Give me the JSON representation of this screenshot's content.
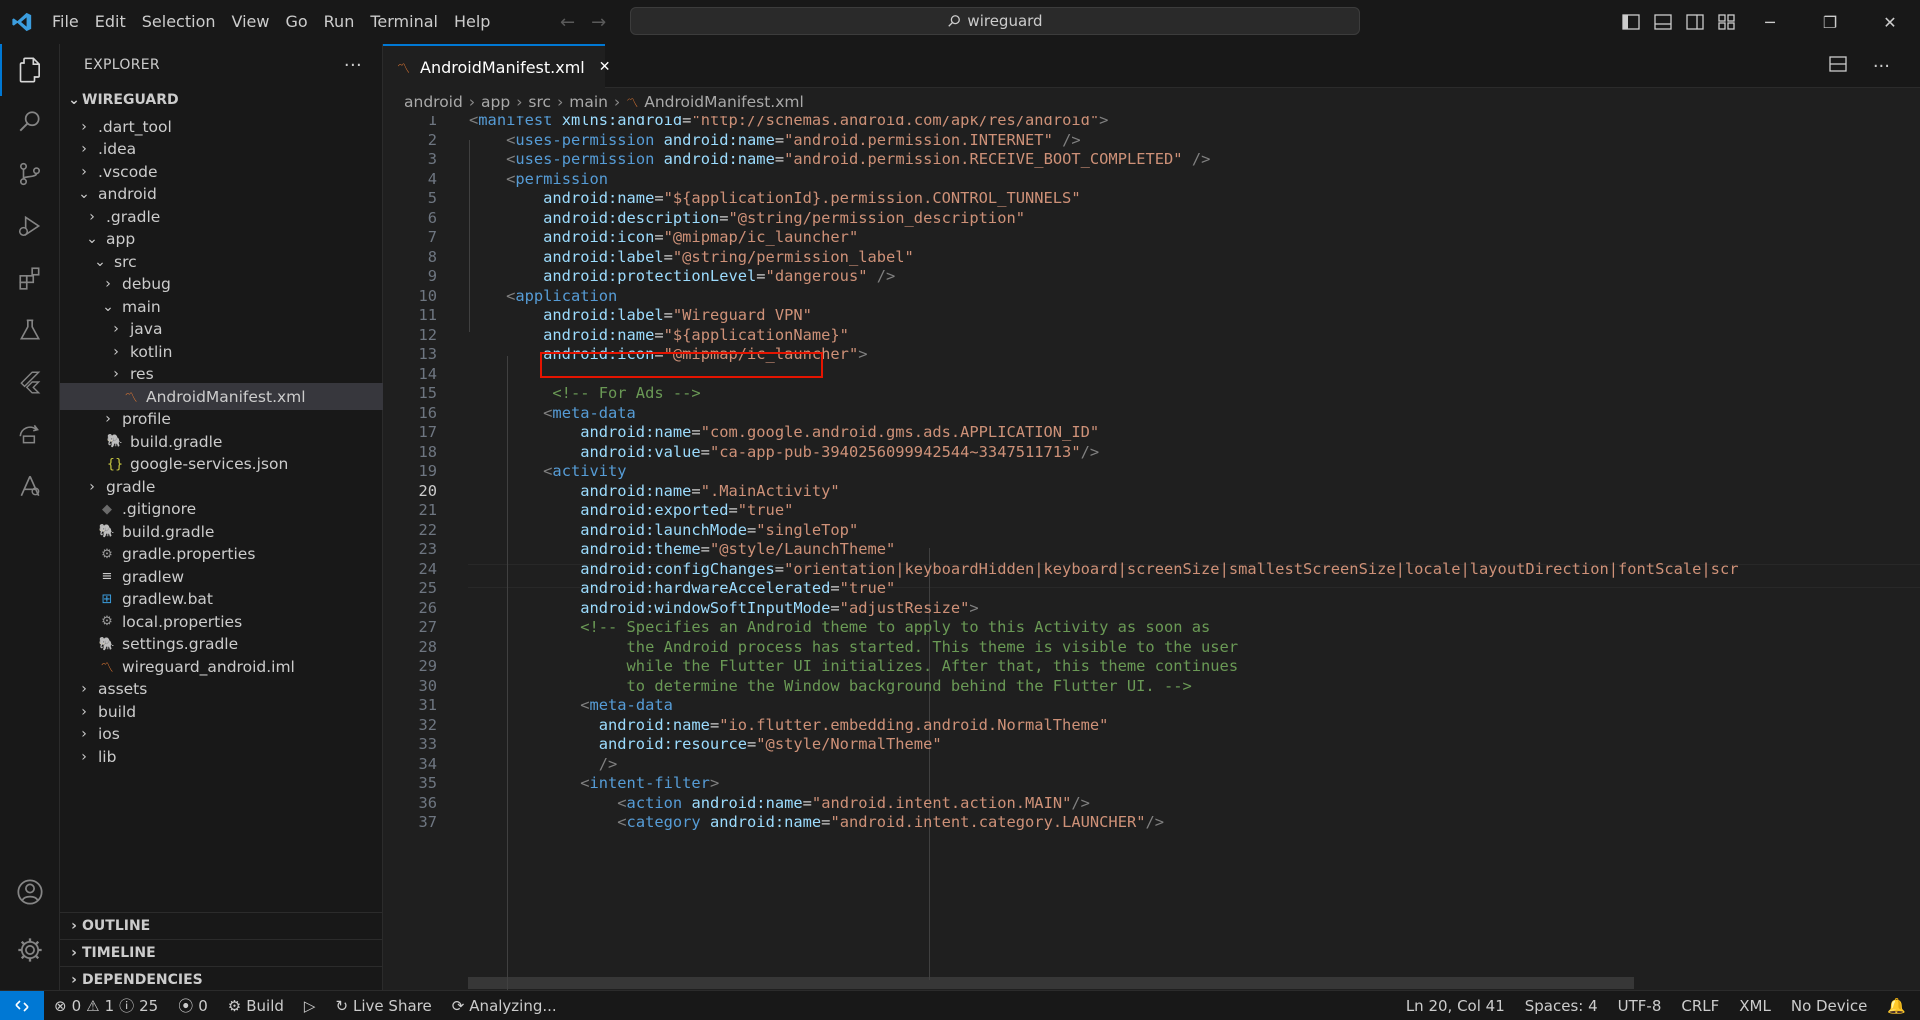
{
  "menu": [
    "File",
    "Edit",
    "Selection",
    "View",
    "Go",
    "Run",
    "Terminal",
    "Help"
  ],
  "command_center": {
    "text": "wireguard",
    "icon": "search-icon"
  },
  "sidebar": {
    "title": "EXPLORER",
    "more": "···",
    "root": "WIREGUARD",
    "tree": [
      {
        "label": ".dart_tool",
        "depth": 1,
        "kind": "folder",
        "open": false,
        "icon": ""
      },
      {
        "label": ".idea",
        "depth": 1,
        "kind": "folder",
        "open": false,
        "icon": ""
      },
      {
        "label": ".vscode",
        "depth": 1,
        "kind": "folder",
        "open": false,
        "icon": ""
      },
      {
        "label": "android",
        "depth": 1,
        "kind": "folder",
        "open": true,
        "icon": ""
      },
      {
        "label": ".gradle",
        "depth": 2,
        "kind": "folder",
        "open": false,
        "icon": ""
      },
      {
        "label": "app",
        "depth": 2,
        "kind": "folder",
        "open": true,
        "icon": ""
      },
      {
        "label": "src",
        "depth": 3,
        "kind": "folder",
        "open": true,
        "icon": ""
      },
      {
        "label": "debug",
        "depth": 4,
        "kind": "folder",
        "open": false,
        "icon": ""
      },
      {
        "label": "main",
        "depth": 4,
        "kind": "folder",
        "open": true,
        "icon": ""
      },
      {
        "label": "java",
        "depth": 5,
        "kind": "folder",
        "open": false,
        "icon": ""
      },
      {
        "label": "kotlin",
        "depth": 5,
        "kind": "folder",
        "open": false,
        "icon": ""
      },
      {
        "label": "res",
        "depth": 5,
        "kind": "folder",
        "open": false,
        "icon": ""
      },
      {
        "label": "AndroidManifest.xml",
        "depth": 5,
        "kind": "file",
        "icon": "rss-icon",
        "selected": true
      },
      {
        "label": "profile",
        "depth": 4,
        "kind": "folder",
        "open": false,
        "icon": ""
      },
      {
        "label": "build.gradle",
        "depth": 3,
        "kind": "file",
        "icon": "gradle-elephant-icon"
      },
      {
        "label": "google-services.json",
        "depth": 3,
        "kind": "file",
        "icon": "json-braces-icon"
      },
      {
        "label": "gradle",
        "depth": 2,
        "kind": "folder",
        "open": false,
        "icon": ""
      },
      {
        "label": ".gitignore",
        "depth": 2,
        "kind": "file",
        "icon": "git-icon"
      },
      {
        "label": "build.gradle",
        "depth": 2,
        "kind": "file",
        "icon": "gradle-elephant-icon"
      },
      {
        "label": "gradle.properties",
        "depth": 2,
        "kind": "file",
        "icon": "gear-icon"
      },
      {
        "label": "gradlew",
        "depth": 2,
        "kind": "file",
        "icon": "lines-icon"
      },
      {
        "label": "gradlew.bat",
        "depth": 2,
        "kind": "file",
        "icon": "windows-icon"
      },
      {
        "label": "local.properties",
        "depth": 2,
        "kind": "file",
        "icon": "gear-icon"
      },
      {
        "label": "settings.gradle",
        "depth": 2,
        "kind": "file",
        "icon": "gradle-elephant-icon"
      },
      {
        "label": "wireguard_android.iml",
        "depth": 2,
        "kind": "file",
        "icon": "rss-icon"
      },
      {
        "label": "assets",
        "depth": 1,
        "kind": "folder",
        "open": false,
        "icon": ""
      },
      {
        "label": "build",
        "depth": 1,
        "kind": "folder",
        "open": false,
        "icon": ""
      },
      {
        "label": "ios",
        "depth": 1,
        "kind": "folder",
        "open": false,
        "icon": ""
      },
      {
        "label": "lib",
        "depth": 1,
        "kind": "folder",
        "open": false,
        "icon": ""
      }
    ],
    "sections": [
      "OUTLINE",
      "TIMELINE",
      "DEPENDENCIES"
    ]
  },
  "tab": {
    "label": "AndroidManifest.xml",
    "close": "✕"
  },
  "breadcrumb": [
    "android",
    "app",
    "src",
    "main",
    "AndroidManifest.xml"
  ],
  "editor": {
    "current_line": 20,
    "lines": [
      [
        [
          "br",
          "<"
        ],
        [
          "tg",
          "manifest"
        ],
        [
          "t",
          " "
        ],
        [
          "at",
          "xmlns:android"
        ],
        [
          "t",
          "="
        ],
        [
          "st",
          "\"http://schemas.android.com/apk/res/android\""
        ],
        [
          "br",
          ">"
        ]
      ],
      [
        [
          "t",
          "    "
        ],
        [
          "br",
          "<"
        ],
        [
          "tg",
          "uses-permission"
        ],
        [
          "t",
          " "
        ],
        [
          "at",
          "android:name"
        ],
        [
          "t",
          "="
        ],
        [
          "st",
          "\"android.permission.INTERNET\""
        ],
        [
          "t",
          " "
        ],
        [
          "br",
          "/>"
        ]
      ],
      [
        [
          "t",
          "    "
        ],
        [
          "br",
          "<"
        ],
        [
          "tg",
          "uses-permission"
        ],
        [
          "t",
          " "
        ],
        [
          "at",
          "android:name"
        ],
        [
          "t",
          "="
        ],
        [
          "st",
          "\"android.permission.RECEIVE_BOOT_COMPLETED\""
        ],
        [
          "t",
          " "
        ],
        [
          "br",
          "/>"
        ]
      ],
      [
        [
          "t",
          "    "
        ],
        [
          "br",
          "<"
        ],
        [
          "tg",
          "permission"
        ]
      ],
      [
        [
          "t",
          "        "
        ],
        [
          "at",
          "android:name"
        ],
        [
          "t",
          "="
        ],
        [
          "st",
          "\"${applicationId}.permission.CONTROL_TUNNELS\""
        ]
      ],
      [
        [
          "t",
          "        "
        ],
        [
          "at",
          "android:description"
        ],
        [
          "t",
          "="
        ],
        [
          "st",
          "\"@string/permission_description\""
        ]
      ],
      [
        [
          "t",
          "        "
        ],
        [
          "at",
          "android:icon"
        ],
        [
          "t",
          "="
        ],
        [
          "st",
          "\"@mipmap/ic_launcher\""
        ]
      ],
      [
        [
          "t",
          "        "
        ],
        [
          "at",
          "android:label"
        ],
        [
          "t",
          "="
        ],
        [
          "st",
          "\"@string/permission_label\""
        ]
      ],
      [
        [
          "t",
          "        "
        ],
        [
          "at",
          "android:protectionLevel"
        ],
        [
          "t",
          "="
        ],
        [
          "st",
          "\"dangerous\""
        ],
        [
          "t",
          " "
        ],
        [
          "br",
          "/>"
        ]
      ],
      [
        [
          "t",
          "    "
        ],
        [
          "br",
          "<"
        ],
        [
          "tg",
          "application"
        ]
      ],
      [
        [
          "t",
          "        "
        ],
        [
          "at",
          "android:label"
        ],
        [
          "t",
          "="
        ],
        [
          "st",
          "\"Wireguard VPN\""
        ]
      ],
      [
        [
          "t",
          "        "
        ],
        [
          "at",
          "android:name"
        ],
        [
          "t",
          "="
        ],
        [
          "st",
          "\"${applicationName}\""
        ]
      ],
      [
        [
          "t",
          "        "
        ],
        [
          "at",
          "android:icon"
        ],
        [
          "t",
          "="
        ],
        [
          "st",
          "\"@mipmap/ic_launcher\""
        ],
        [
          "br",
          ">"
        ]
      ],
      [],
      [
        [
          "t",
          "         "
        ],
        [
          "cm",
          "<!-- For Ads -->"
        ]
      ],
      [
        [
          "t",
          "        "
        ],
        [
          "br",
          "<"
        ],
        [
          "tg",
          "meta-data"
        ]
      ],
      [
        [
          "t",
          "            "
        ],
        [
          "at",
          "android:name"
        ],
        [
          "t",
          "="
        ],
        [
          "st",
          "\"com.google.android.gms.ads.APPLICATION_ID\""
        ]
      ],
      [
        [
          "t",
          "            "
        ],
        [
          "at",
          "android:value"
        ],
        [
          "t",
          "="
        ],
        [
          "st",
          "\"ca-app-pub-3940256099942544~3347511713\""
        ],
        [
          "br",
          "/>"
        ]
      ],
      [
        [
          "t",
          "        "
        ],
        [
          "br",
          "<"
        ],
        [
          "tg",
          "activity"
        ]
      ],
      [
        [
          "t",
          "            "
        ],
        [
          "at",
          "android:name"
        ],
        [
          "t",
          "="
        ],
        [
          "st",
          "\".MainActivity\""
        ]
      ],
      [
        [
          "t",
          "            "
        ],
        [
          "at",
          "android:exported"
        ],
        [
          "t",
          "="
        ],
        [
          "st",
          "\"true\""
        ]
      ],
      [
        [
          "t",
          "            "
        ],
        [
          "at",
          "android:launchMode"
        ],
        [
          "t",
          "="
        ],
        [
          "st",
          "\"singleTop\""
        ]
      ],
      [
        [
          "t",
          "            "
        ],
        [
          "at",
          "android:theme"
        ],
        [
          "t",
          "="
        ],
        [
          "st",
          "\"@style/LaunchTheme\""
        ]
      ],
      [
        [
          "t",
          "            "
        ],
        [
          "at",
          "android:configChanges"
        ],
        [
          "t",
          "="
        ],
        [
          "st",
          "\"orientation|keyboardHidden|keyboard|screenSize|smallestScreenSize|locale|layoutDirection|fontScale|scr"
        ]
      ],
      [
        [
          "t",
          "            "
        ],
        [
          "at",
          "android:hardwareAccelerated"
        ],
        [
          "t",
          "="
        ],
        [
          "st",
          "\"true\""
        ]
      ],
      [
        [
          "t",
          "            "
        ],
        [
          "at",
          "android:windowSoftInputMode"
        ],
        [
          "t",
          "="
        ],
        [
          "st",
          "\"adjustResize\""
        ],
        [
          "br",
          ">"
        ]
      ],
      [
        [
          "t",
          "            "
        ],
        [
          "cm",
          "<!-- Specifies an Android theme to apply to this Activity as soon as"
        ]
      ],
      [
        [
          "t",
          "                 "
        ],
        [
          "cm",
          "the Android process has started. This theme is visible to the user"
        ]
      ],
      [
        [
          "t",
          "                 "
        ],
        [
          "cm",
          "while the Flutter UI initializes. After that, this theme continues"
        ]
      ],
      [
        [
          "t",
          "                 "
        ],
        [
          "cm",
          "to determine the Window background behind the Flutter UI. -->"
        ]
      ],
      [
        [
          "t",
          "            "
        ],
        [
          "br",
          "<"
        ],
        [
          "tg",
          "meta-data"
        ]
      ],
      [
        [
          "t",
          "              "
        ],
        [
          "at",
          "android:name"
        ],
        [
          "t",
          "="
        ],
        [
          "st",
          "\"io.flutter.embedding.android.NormalTheme\""
        ]
      ],
      [
        [
          "t",
          "              "
        ],
        [
          "at",
          "android:resource"
        ],
        [
          "t",
          "="
        ],
        [
          "st",
          "\"@style/NormalTheme\""
        ]
      ],
      [
        [
          "t",
          "              "
        ],
        [
          "br",
          "/>"
        ]
      ],
      [
        [
          "t",
          "            "
        ],
        [
          "br",
          "<"
        ],
        [
          "tg",
          "intent-filter"
        ],
        [
          "br",
          ">"
        ]
      ],
      [
        [
          "t",
          "                "
        ],
        [
          "br",
          "<"
        ],
        [
          "tg",
          "action"
        ],
        [
          "t",
          " "
        ],
        [
          "at",
          "android:name"
        ],
        [
          "t",
          "="
        ],
        [
          "st",
          "\"android.intent.action.MAIN\""
        ],
        [
          "br",
          "/>"
        ]
      ],
      [
        [
          "t",
          "                "
        ],
        [
          "br",
          "<"
        ],
        [
          "tg",
          "category"
        ],
        [
          "t",
          " "
        ],
        [
          "at",
          "android:name"
        ],
        [
          "t",
          "="
        ],
        [
          "st",
          "\"android.intent.category.LAUNCHER\""
        ],
        [
          "br",
          "/>"
        ]
      ]
    ]
  },
  "status": {
    "errors": "0",
    "warnings": "1",
    "info": "25",
    "ports": "0",
    "build": "Build",
    "live_share": "Live Share",
    "analyzing": "Analyzing...",
    "position": "Ln 20, Col 41",
    "spaces": "Spaces: 4",
    "encoding": "UTF-8",
    "eol": "CRLF",
    "language": "XML",
    "device": "No Device"
  },
  "colors": {
    "accent": "#0078d4",
    "highlight": "#e51400"
  }
}
